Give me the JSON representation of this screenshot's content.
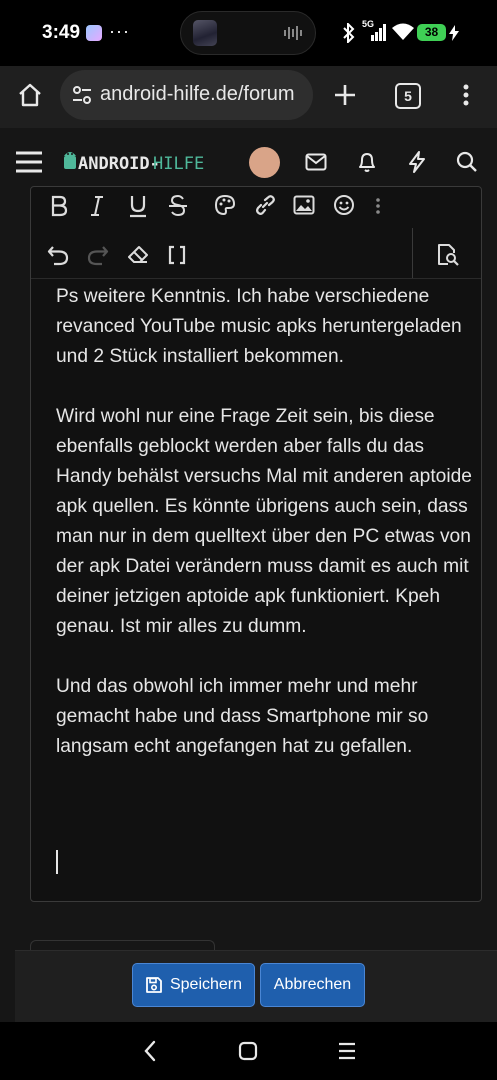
{
  "status_bar": {
    "time": "3:49",
    "more_indicator": "···",
    "network": "5G",
    "battery": "38"
  },
  "browser": {
    "url": "android-hilfe.de/forum",
    "tab_count": "5"
  },
  "forum_header": {
    "logo_part1": "ANDROID-",
    "logo_part2": "HILFE"
  },
  "editor": {
    "paragraphs": [
      "Ps weitere Kenntnis. Ich habe verschiedene revanced YouTube music apks heruntergeladen und 2 Stück installiert bekommen.",
      "Wird wohl nur eine Frage Zeit sein, bis diese ebenfalls geblockt werden aber falls du das Handy behälst versuchs Mal mit anderen aptoide apk quellen. Es könnte übrigens auch sein, dass man nur in dem quelltext über den PC etwas von der apk Datei verändern muss damit es auch mit deiner jetzigen aptoide apk funktioniert. Kpeh genau. Ist mir alles zu dumm.",
      "Und das obwohl ich immer mehr und mehr gemacht habe und dass Smartphone mir so langsam echt angefangen hat zu gefallen."
    ]
  },
  "actions": {
    "save_label": "Speichern",
    "cancel_label": "Abbrechen"
  },
  "colors": {
    "accent": "#1f5fad",
    "logo_green": "#4fb89a",
    "battery_green": "#3fcf55"
  }
}
